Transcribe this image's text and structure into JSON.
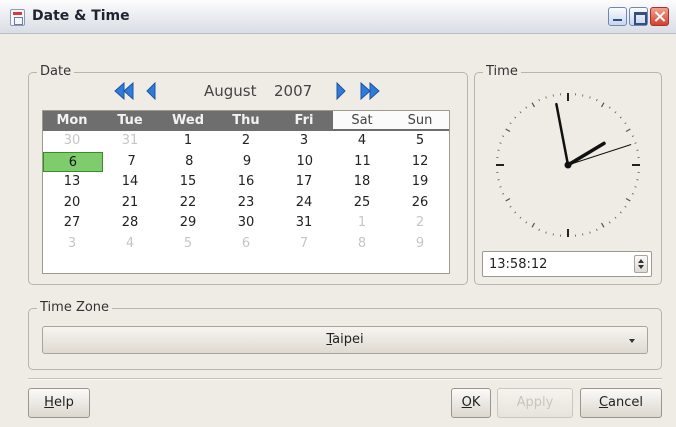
{
  "window": {
    "title": "Date & Time"
  },
  "date": {
    "legend": "Date",
    "month": "August",
    "year": "2007",
    "weekdays": [
      "Mon",
      "Tue",
      "Wed",
      "Thu",
      "Fri",
      "Sat",
      "Sun"
    ],
    "weeks": [
      [
        "30",
        "31",
        "1",
        "2",
        "3",
        "4",
        "5"
      ],
      [
        "6",
        "7",
        "8",
        "9",
        "10",
        "11",
        "12"
      ],
      [
        "13",
        "14",
        "15",
        "16",
        "17",
        "18",
        "19"
      ],
      [
        "20",
        "21",
        "22",
        "23",
        "24",
        "25",
        "26"
      ],
      [
        "27",
        "28",
        "29",
        "30",
        "31",
        "1",
        "2"
      ],
      [
        "3",
        "4",
        "5",
        "6",
        "7",
        "8",
        "9"
      ]
    ],
    "selected_day": "6"
  },
  "time": {
    "legend": "Time",
    "value": "13:58:12",
    "hour": 13,
    "minute": 58,
    "second": 12
  },
  "timezone": {
    "legend": "Time Zone",
    "selected": "Taipei",
    "mnemonic": "T",
    "rest": "aipei"
  },
  "buttons": {
    "help": {
      "mnemonic": "H",
      "rest": "elp"
    },
    "ok": {
      "mnemonic": "O",
      "rest": "K"
    },
    "apply": {
      "label": "Apply",
      "enabled": false
    },
    "cancel": {
      "mnemonic": "C",
      "rest": "ancel"
    }
  },
  "colors": {
    "accent_blue": "#2f7bd9",
    "selected_day": "#7fcc6c",
    "header_dark": "#6e6e6e"
  }
}
